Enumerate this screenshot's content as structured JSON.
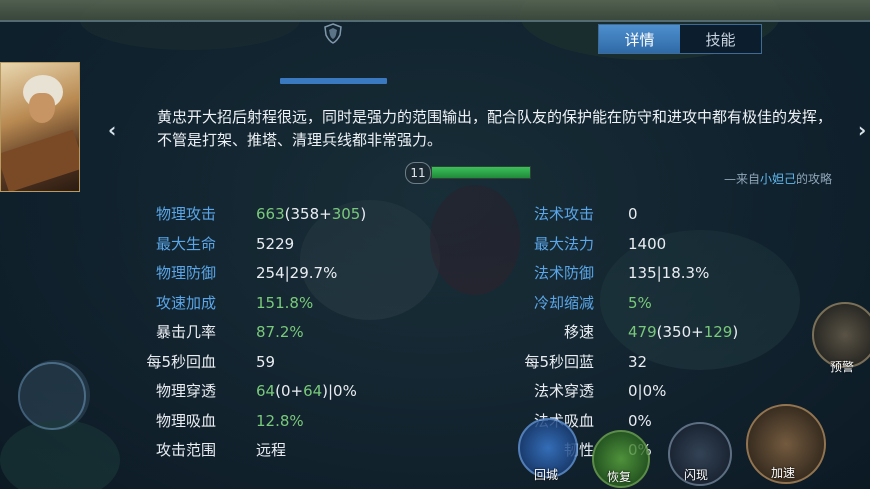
{
  "tabs": [
    {
      "label": "详情",
      "active": true
    },
    {
      "label": "技能",
      "active": false
    }
  ],
  "nav": {
    "prev_icon": "chevron-left-icon",
    "next_icon": "chevron-right-icon"
  },
  "description": "黄忠开大招后射程很远，同时是强力的范围输出，配合队友的保护能在防守和进攻中都有极佳的发挥，不管是打架、推塔、清理兵线都非常强力。",
  "guide": {
    "prefix": "—来自",
    "author": "小妲己",
    "suffix": "的攻略"
  },
  "level": {
    "value": "11",
    "bar_fill": 1.0
  },
  "stats_left": [
    {
      "label": "物理攻击",
      "label_color": "blue",
      "parts": [
        {
          "text": "663",
          "c": "g"
        },
        {
          "text": "(358+",
          "c": "w"
        },
        {
          "text": "305",
          "c": "g"
        },
        {
          "text": ")",
          "c": "w"
        }
      ]
    },
    {
      "label": "最大生命",
      "label_color": "blue",
      "parts": [
        {
          "text": "5229",
          "c": "w"
        }
      ]
    },
    {
      "label": "物理防御",
      "label_color": "blue",
      "parts": [
        {
          "text": "254|29.7%",
          "c": "w"
        }
      ]
    },
    {
      "label": "攻速加成",
      "label_color": "blue",
      "parts": [
        {
          "text": "151.8%",
          "c": "g"
        }
      ]
    },
    {
      "label": "暴击几率",
      "label_color": "white",
      "parts": [
        {
          "text": "87.2%",
          "c": "g"
        }
      ]
    },
    {
      "label": "每5秒回血",
      "label_color": "white",
      "parts": [
        {
          "text": "59",
          "c": "w"
        }
      ]
    },
    {
      "label": "物理穿透",
      "label_color": "white",
      "parts": [
        {
          "text": "64",
          "c": "g"
        },
        {
          "text": "(0+",
          "c": "w"
        },
        {
          "text": "64",
          "c": "g"
        },
        {
          "text": ")|0%",
          "c": "w"
        }
      ]
    },
    {
      "label": "物理吸血",
      "label_color": "white",
      "parts": [
        {
          "text": "12.8%",
          "c": "g"
        }
      ]
    },
    {
      "label": "攻击范围",
      "label_color": "white",
      "parts": [
        {
          "text": "远程",
          "c": "w"
        }
      ]
    }
  ],
  "stats_right": [
    {
      "label": "法术攻击",
      "label_color": "blue",
      "parts": [
        {
          "text": "0",
          "c": "w"
        }
      ]
    },
    {
      "label": "最大法力",
      "label_color": "blue",
      "parts": [
        {
          "text": "1400",
          "c": "w"
        }
      ]
    },
    {
      "label": "法术防御",
      "label_color": "blue",
      "parts": [
        {
          "text": "135|18.3%",
          "c": "w"
        }
      ]
    },
    {
      "label": "冷却缩减",
      "label_color": "blue",
      "parts": [
        {
          "text": "5%",
          "c": "g"
        }
      ]
    },
    {
      "label": "移速",
      "label_color": "white",
      "parts": [
        {
          "text": "479",
          "c": "g"
        },
        {
          "text": "(350+",
          "c": "w"
        },
        {
          "text": "129",
          "c": "g"
        },
        {
          "text": ")",
          "c": "w"
        }
      ]
    },
    {
      "label": "每5秒回蓝",
      "label_color": "white",
      "parts": [
        {
          "text": "32",
          "c": "w"
        }
      ]
    },
    {
      "label": "法术穿透",
      "label_color": "white",
      "parts": [
        {
          "text": "0|0%",
          "c": "w"
        }
      ]
    },
    {
      "label": "法术吸血",
      "label_color": "white",
      "parts": [
        {
          "text": "0%",
          "c": "w"
        }
      ]
    },
    {
      "label": "韧性",
      "label_color": "white",
      "parts": [
        {
          "text": "0%",
          "c": "w"
        }
      ]
    }
  ],
  "skills": [
    {
      "label": "回城",
      "icon": "recall-icon"
    },
    {
      "label": "恢复",
      "icon": "heal-icon"
    },
    {
      "label": "闪现",
      "icon": "flash-icon"
    },
    {
      "label": "加速",
      "icon": "speed-up-icon"
    },
    {
      "label": "预警",
      "icon": "alert-icon"
    }
  ],
  "colors": {
    "accent": "#3f7fc0",
    "stat_label_blue": "#5aa6e8",
    "stat_value_green": "#79c97a"
  }
}
